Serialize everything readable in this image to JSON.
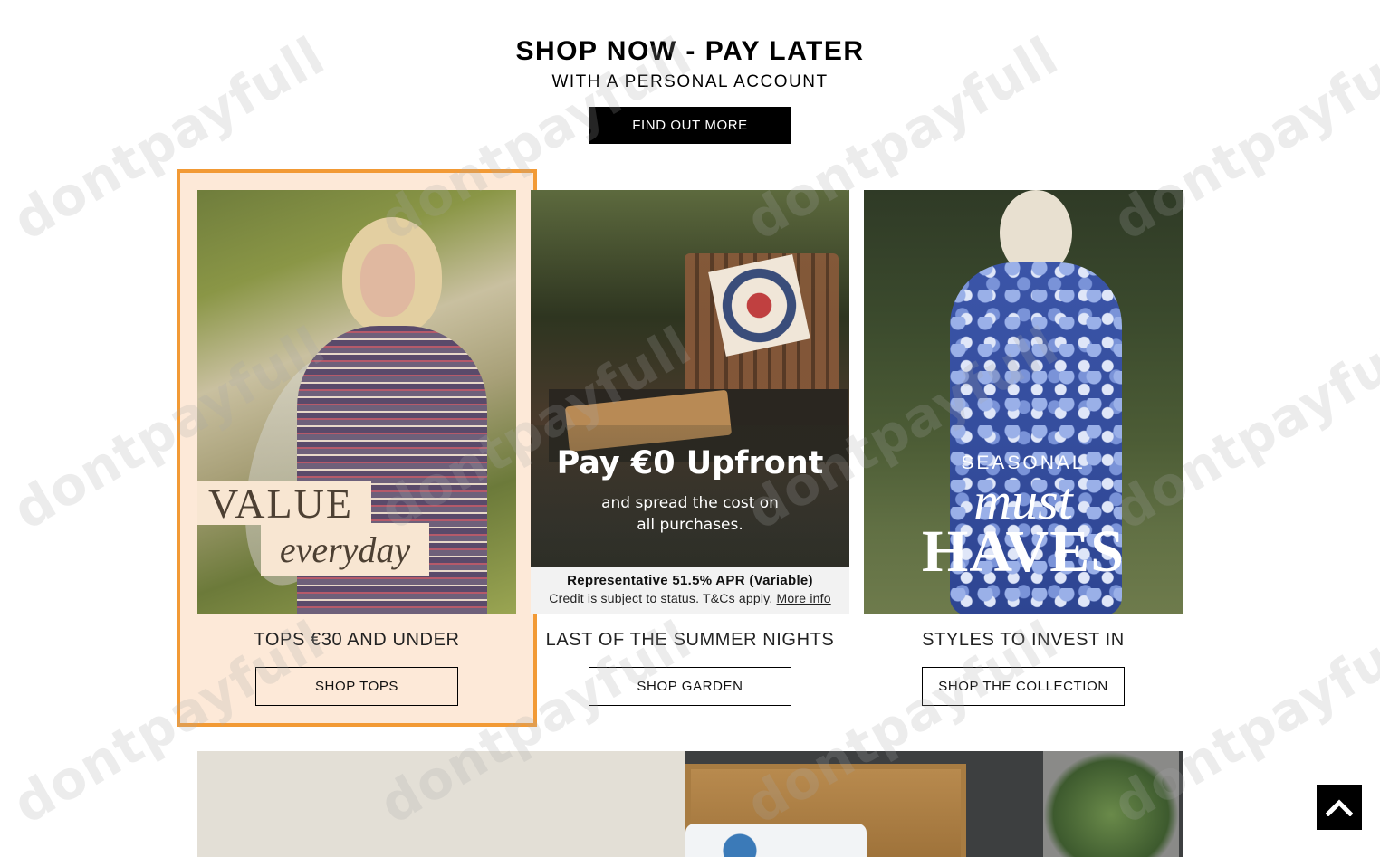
{
  "promo": {
    "title": "SHOP NOW - PAY LATER",
    "subtitle": "WITH A PERSONAL ACCOUNT",
    "button_label": "FIND OUT MORE"
  },
  "cards": [
    {
      "title": "TOPS €30 AND UNDER",
      "button_label": "SHOP TOPS",
      "overlay_line1": "VALUE",
      "overlay_line2": "everyday",
      "highlighted": true,
      "highlight_color": "#f29a35",
      "highlight_bg": "#fde9d8"
    },
    {
      "title": "LAST OF THE SUMMER NIGHTS",
      "button_label": "SHOP GARDEN",
      "overlay_headline": "Pay €0 Upfront",
      "overlay_sub_line1": "and spread the cost on",
      "overlay_sub_line2": "all purchases.",
      "apr_line": "Representative 51.5% APR (Variable)",
      "credit_text": "Credit is subject to status. T&Cs apply.",
      "more_info_link": "More info"
    },
    {
      "title": "STYLES TO INVEST IN",
      "button_label": "SHOP THE COLLECTION",
      "overlay_line1": "SEASONAL",
      "overlay_line2": "must",
      "overlay_line3": "HAVES"
    }
  ],
  "watermark": "dontpayfull",
  "back_to_top_icon": "chevron-up-icon"
}
